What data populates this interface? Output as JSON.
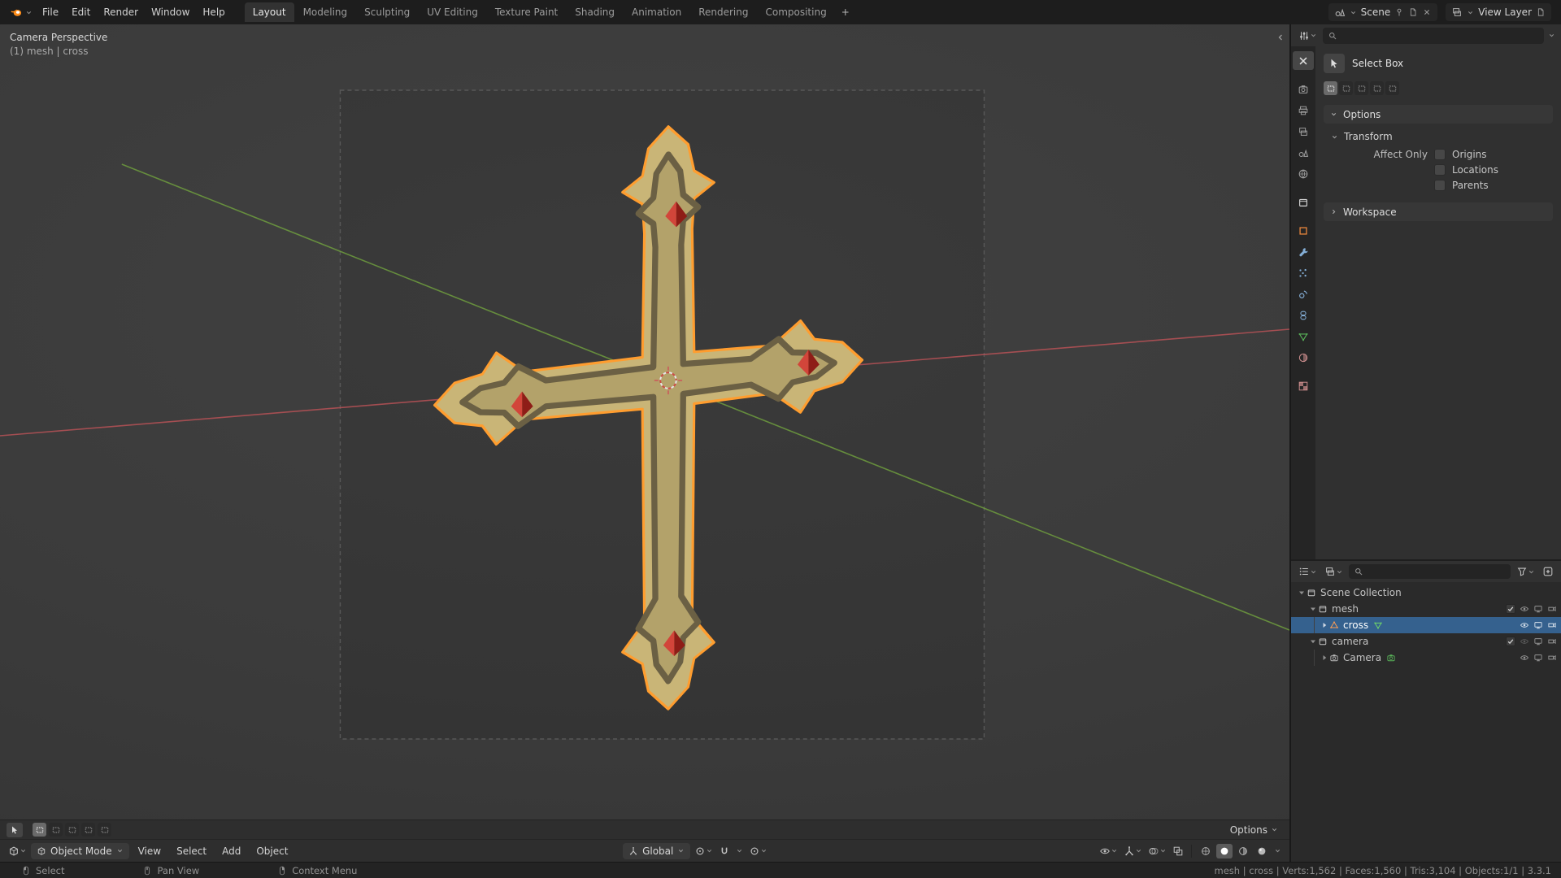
{
  "topbar": {
    "menus": [
      "File",
      "Edit",
      "Render",
      "Window",
      "Help"
    ],
    "tabs": [
      "Layout",
      "Modeling",
      "Sculpting",
      "UV Editing",
      "Texture Paint",
      "Shading",
      "Animation",
      "Rendering",
      "Compositing"
    ],
    "add_tab": "+",
    "scene": {
      "label": "Scene"
    },
    "view_layer": {
      "label": "View Layer"
    }
  },
  "viewport": {
    "overlay": {
      "view": "Camera Perspective",
      "object_info": "(1) mesh | cross"
    },
    "tool_header": {
      "options": "Options"
    },
    "header": {
      "mode": "Object Mode",
      "menus": [
        "View",
        "Select",
        "Add",
        "Object"
      ],
      "orientation": "Global"
    }
  },
  "properties": {
    "tool": {
      "name": "Select Box"
    },
    "panels": {
      "options": "Options",
      "transform": "Transform",
      "workspace": "Workspace"
    },
    "transform": {
      "affect_only": "Affect Only",
      "options": [
        "Origins",
        "Locations",
        "Parents"
      ]
    }
  },
  "outliner": {
    "root": "Scene Collection",
    "collections": [
      {
        "name": "mesh",
        "children": [
          "cross"
        ]
      },
      {
        "name": "camera",
        "children": [
          "Camera"
        ]
      }
    ]
  },
  "statusbar": {
    "hints": [
      "Select",
      "Pan View",
      "Context Menu"
    ],
    "stats": "mesh | cross | Verts:1,562 | Faces:1,560 | Tris:3,104 | Objects:1/1 | 3.3.1"
  },
  "colors": {
    "accent_orange": "#e8853c",
    "selection_outline": "#ff9d2f",
    "selection_blue": "#35618e",
    "cross_gold": "#c9b577",
    "gem_red": "#c0322a",
    "axis_x_red": "#bf5358",
    "axis_y_green": "#71a23e"
  }
}
